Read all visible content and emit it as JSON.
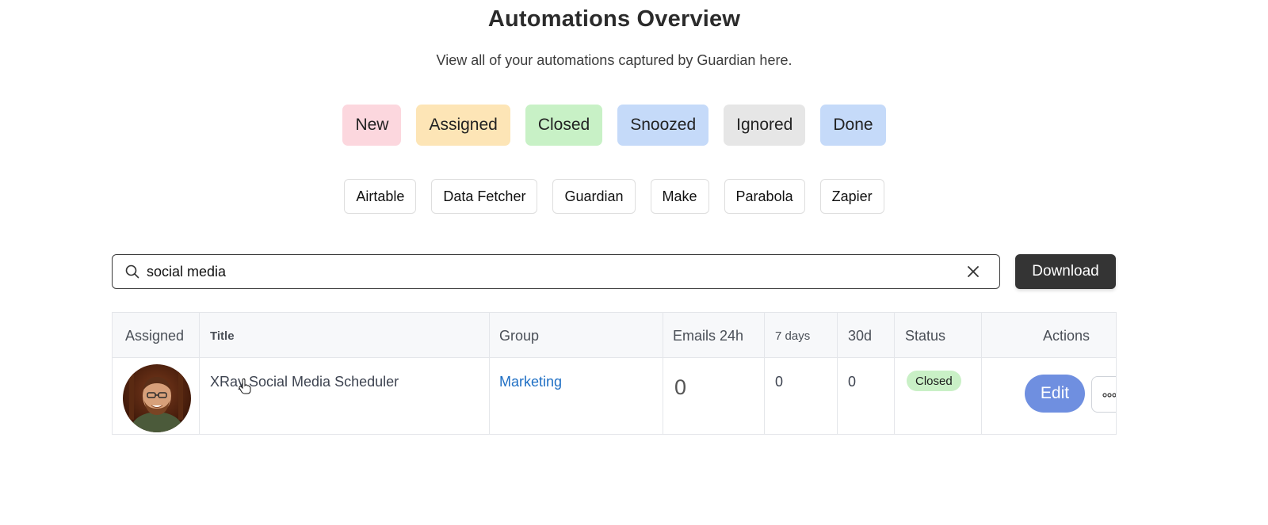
{
  "header": {
    "title": "Automations Overview",
    "subtitle": "View all of your automations captured by Guardian here."
  },
  "status_filters": [
    {
      "label": "New",
      "color": "#fcd7de"
    },
    {
      "label": "Assigned",
      "color": "#fde5b6"
    },
    {
      "label": "Closed",
      "color": "#c8f1c6"
    },
    {
      "label": "Snoozed",
      "color": "#c5daf9"
    },
    {
      "label": "Ignored",
      "color": "#e6e6e6"
    },
    {
      "label": "Done",
      "color": "#c5daf9"
    }
  ],
  "source_filters": [
    "Airtable",
    "Data Fetcher",
    "Guardian",
    "Make",
    "Parabola",
    "Zapier"
  ],
  "search": {
    "value": "social media",
    "icon": "search-icon",
    "clear_icon": "close-icon"
  },
  "download_label": "Download",
  "table": {
    "headers": {
      "assigned": "Assigned",
      "title": "Title",
      "group": "Group",
      "emails_24h": "Emails 24h",
      "days7": "7 days",
      "d30": "30d",
      "status": "Status",
      "actions": "Actions"
    },
    "rows": [
      {
        "title": "XRay Social Media Scheduler",
        "group": "Marketing",
        "emails_24h": "0",
        "days7": "0",
        "d30": "0",
        "status": "Closed",
        "edit_label": "Edit"
      }
    ]
  },
  "colors": {
    "accent_button": "#6f8fe0",
    "download_bg": "#343434",
    "link": "#1f6fc4",
    "closed_badge": "#c9f0c6"
  }
}
